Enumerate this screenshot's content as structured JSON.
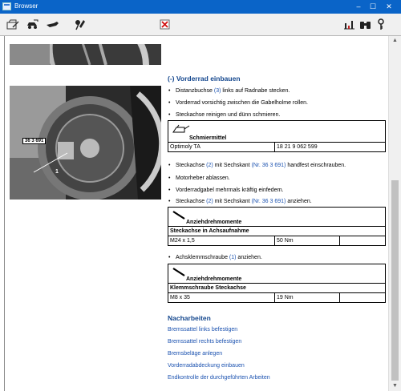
{
  "window": {
    "title": "Browser",
    "minimize": "–",
    "maximize": "☐",
    "close": "✕"
  },
  "photo": {
    "label": "36 3 691",
    "callout": "1"
  },
  "procedure": {
    "title": "(-) Vorderrad einbauen",
    "steps1": [
      {
        "bullet": "•",
        "pre": "Distanzbuchse ",
        "ref": "(3)",
        "post": " links auf Radnabe stecken."
      },
      {
        "bullet": "•",
        "pre": "Vorderrad vorsichtig zwischen die Gabelholme rollen.",
        "ref": "",
        "post": ""
      },
      {
        "bullet": "•",
        "pre": "Steckachse reinigen und dünn schmieren.",
        "ref": "",
        "post": ""
      }
    ],
    "lubricant": {
      "header": "Schmiermittel",
      "name": "Optimoly TA",
      "partno": "18 21 9 062 599"
    },
    "steps2": [
      {
        "bullet": "•",
        "pre": "Steckachse ",
        "ref": "(2)",
        "mid": " mit Sechskant ",
        "tool": "(Nr. 36 3 691)",
        "post": " handfest einschrauben."
      },
      {
        "bullet": "•",
        "pre": "Motorheber ablassen.",
        "ref": "",
        "mid": "",
        "tool": "",
        "post": ""
      },
      {
        "bullet": "•",
        "pre": "Vorderradgabel mehrmals kräftig einfedern.",
        "ref": "",
        "mid": "",
        "tool": "",
        "post": ""
      },
      {
        "bullet": "•",
        "pre": "Steckachse ",
        "ref": "(2)",
        "mid": " mit Sechskant ",
        "tool": "(Nr. 36 3 691)",
        "post": " anziehen."
      }
    ],
    "torque1": {
      "header": "Anziehdrehmomente",
      "sub": "Steckachse in Achsaufnahme",
      "spec": "M24 x 1,5",
      "value": "50 Nm"
    },
    "step3": {
      "bullet": "•",
      "pre": "Achsklemmschraube ",
      "ref": "(1)",
      "post": " anziehen."
    },
    "torque2": {
      "header": "Anziehdrehmomente",
      "sub": "Klemmschraube Steckachse",
      "spec": "M8 x 35",
      "value": "19 Nm"
    }
  },
  "nacharbeiten": {
    "title": "Nacharbeiten",
    "links": [
      "Bremssattel links befestigen",
      "Bremssattel rechts befestigen",
      "Bremsbeläge anlegen",
      "Vorderradabdeckung einbauen",
      "Endkontrolle der durchgeführten Arbeiten"
    ]
  },
  "colors": {
    "titlebar": "#0a64c8",
    "heading": "#14478e",
    "link": "#1b52b0"
  },
  "toolbar_icons": [
    "doc-edit-icon",
    "car-tool-icon",
    "hand-pointer-icon",
    "pen-tool-icon",
    "cancel-icon",
    "chart-icon",
    "binoculars-icon",
    "key-icon"
  ]
}
